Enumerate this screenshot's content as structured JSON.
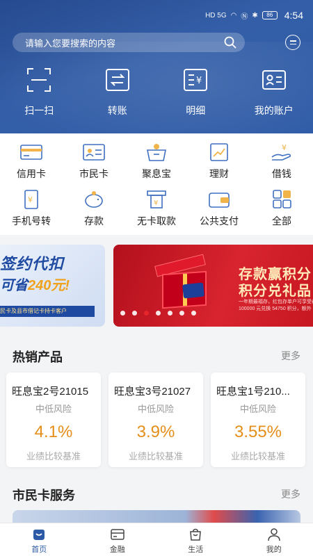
{
  "status_bar": {
    "network": "HD 5G",
    "battery": "86",
    "time": "4:54"
  },
  "search": {
    "placeholder": "请输入您要搜索的内容"
  },
  "quick_actions": [
    {
      "label": "扫一扫",
      "icon": "scan-icon"
    },
    {
      "label": "转账",
      "icon": "transfer-icon"
    },
    {
      "label": "明细",
      "icon": "statement-icon"
    },
    {
      "label": "我的账户",
      "icon": "account-icon"
    }
  ],
  "services": [
    {
      "label": "信用卡",
      "icon": "credit-card-icon"
    },
    {
      "label": "市民卡",
      "icon": "citizen-card-icon"
    },
    {
      "label": "聚息宝",
      "icon": "interest-basket-icon"
    },
    {
      "label": "理财",
      "icon": "wealth-chart-icon"
    },
    {
      "label": "借钱",
      "icon": "loan-hand-icon"
    },
    {
      "label": "手机号转",
      "icon": "phone-transfer-icon"
    },
    {
      "label": "存款",
      "icon": "piggy-bank-icon"
    },
    {
      "label": "无卡取款",
      "icon": "cardless-withdraw-icon"
    },
    {
      "label": "公共支付",
      "icon": "wallet-icon"
    },
    {
      "label": "全部",
      "icon": "grid-all-icon"
    }
  ],
  "banners": {
    "left": {
      "line1": "签约代扣",
      "line2_prefix": "可省",
      "line2_amount": "240元!",
      "line3": "民卡及县市借记卡持卡客户"
    },
    "main": {
      "line1": "存款赢积分",
      "line2": "积分兑礼品",
      "fine1": "一年期最福存，红包存单户可享受存",
      "fine2": "100000 元兑换 54750 积分，额外"
    },
    "dots_count": 7,
    "active_dot": 2
  },
  "hot_products": {
    "title": "热销产品",
    "more": "更多",
    "items": [
      {
        "name": "旺息宝2号21015",
        "risk": "中低风险",
        "rate": "4.1%",
        "benchmark": "业绩比较基准"
      },
      {
        "name": "旺息宝3号21027",
        "risk": "中低风险",
        "rate": "3.9%",
        "benchmark": "业绩比较基准"
      },
      {
        "name": "旺息宝1号210...",
        "risk": "中低风险",
        "rate": "3.55%",
        "benchmark": "业绩比较基准"
      }
    ]
  },
  "citizen_services": {
    "title": "市民卡服务",
    "more": "更多"
  },
  "tabbar": [
    {
      "label": "首页",
      "icon": "home-icon",
      "active": true
    },
    {
      "label": "金融",
      "icon": "finance-card-icon",
      "active": false
    },
    {
      "label": "生活",
      "icon": "shopping-bag-icon",
      "active": false
    },
    {
      "label": "我的",
      "icon": "profile-icon",
      "active": false
    }
  ],
  "colors": {
    "header_blue": "#2d5aa6",
    "accent_orange": "#e58e1a",
    "promo_red": "#d8242e"
  }
}
